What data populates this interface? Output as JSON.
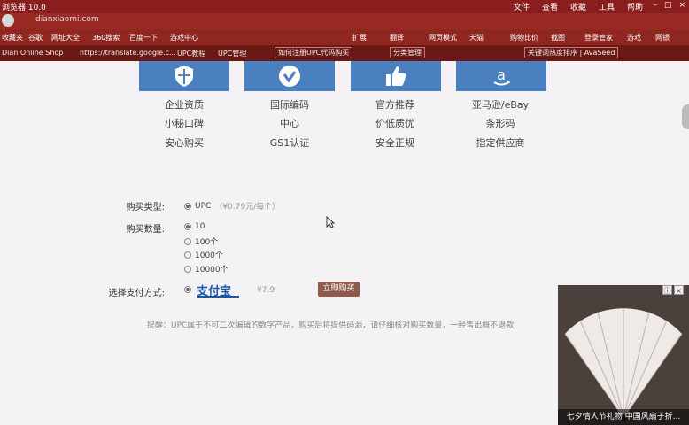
{
  "browser": {
    "window_title": "浏览器 10.0",
    "menu": [
      "文件",
      "查看",
      "收藏",
      "工具",
      "帮助"
    ],
    "address": "dianxiaomi.com",
    "favorites": [
      "收藏夹",
      "谷歌",
      "网址大全",
      "360搜索",
      "百度一下",
      "游戏中心",
      "扩展",
      "翻译",
      "网页模式",
      "天猫",
      "购物比价",
      "截图",
      "登录管家",
      "游戏",
      "网银"
    ],
    "tabs": [
      "Dian Online Shop",
      "https://translate.google.c...",
      "UPC教程",
      "UPC管理",
      "如何注册UPC代码购买",
      "分类管理",
      "关键词热度排序 | AvaSeed"
    ]
  },
  "features": [
    {
      "icon": "shield-icon",
      "lines": [
        "企业资质",
        "小秘口碑",
        "安心购买"
      ]
    },
    {
      "icon": "check-badge-icon",
      "lines": [
        "国际编码",
        "中心",
        "GS1认证"
      ]
    },
    {
      "icon": "thumbs-up-icon",
      "lines": [
        "官方推荐",
        "价低质优",
        "安全正规"
      ]
    },
    {
      "icon": "amazon-logo-icon",
      "lines": [
        "亚马逊/eBay",
        "条形码",
        "指定供应商"
      ]
    }
  ],
  "form": {
    "type_label": "购买类型:",
    "type_option": "UPC",
    "type_price": "（¥0.79元/每个）",
    "qty_label": "购买数量:",
    "qty_options": [
      "10",
      "100个",
      "1000个",
      "10000个"
    ],
    "pay_label": "选择支付方式:",
    "pay_method": "支付宝",
    "total": "¥7.9",
    "buy_button": "立即购买"
  },
  "note": "提醒：UPC属于不可二次编辑的数字产品，购买后将提供码源，请仔细核对购买数量，一经售出概不退款",
  "ad": {
    "caption": "七夕情人节礼物 中国风扇子折...",
    "close": "×",
    "info": "ⓘ"
  }
}
